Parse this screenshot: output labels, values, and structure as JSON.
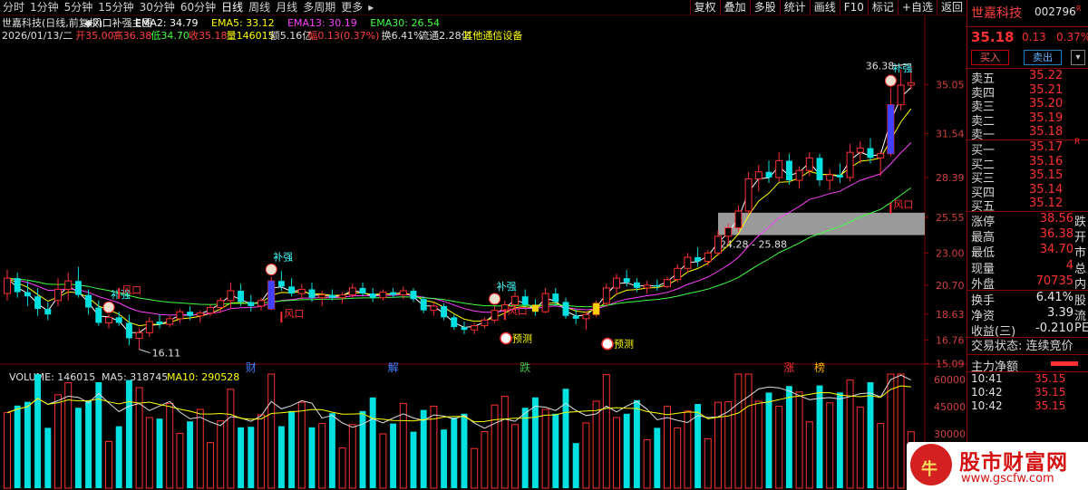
{
  "toolbar": {
    "periods": [
      "分时",
      "1分钟",
      "5分钟",
      "15分钟",
      "30分钟",
      "60分钟",
      "日线",
      "周线",
      "月线",
      "多周期",
      "更多"
    ],
    "active_period": "日线",
    "more_arrow": "▸",
    "right_buttons": [
      "复权",
      "叠加",
      "多股",
      "统计",
      "画线",
      "F10",
      "标记",
      "+自选",
      "返回"
    ]
  },
  "header": {
    "title": "世嘉科技(日线,前复权)",
    "indicator_name": "风口补强主图",
    "ema_labels": [
      "EMA2: 34.79",
      "EMA5: 33.12",
      "EMA13: 30.19",
      "EMA30: 26.54"
    ],
    "ema_colors": [
      "#ffffff",
      "#ffff00",
      "#ff40ff",
      "#40ff40"
    ],
    "info_date": "2026/01/13/二",
    "info_open": "开35.00",
    "info_high": "高36.38",
    "info_low": "低34.70",
    "info_close": "收35.18",
    "info_volume": "量146015",
    "info_amount": "额5.16亿",
    "info_range": "幅0.13(0.37%)",
    "info_turnover": "换6.41%",
    "info_float": "流通2.28亿",
    "info_sector": "其他通信设备"
  },
  "volume_header": {
    "volume": "VOLUME: 146015",
    "ma5": "MA5: 318745",
    "ma10": "MA10: 290528"
  },
  "side": {
    "name": "世嘉科技",
    "code": "002796",
    "code_flag": "R",
    "price": "35.18",
    "change": "0.13",
    "change_pct": "0.37%",
    "buy_btn": "买入",
    "sell_btn": "卖出",
    "more_btn": "▾",
    "asks": [
      {
        "label": "卖五",
        "price": "35.22"
      },
      {
        "label": "卖四",
        "price": "35.21"
      },
      {
        "label": "卖三",
        "price": "35.20"
      },
      {
        "label": "卖二",
        "price": "35.19"
      },
      {
        "label": "卖一",
        "price": "35.18"
      }
    ],
    "bids": [
      {
        "label": "买一",
        "price": "35.17",
        "flag": "R"
      },
      {
        "label": "买二",
        "price": "35.16"
      },
      {
        "label": "买三",
        "price": "35.15"
      },
      {
        "label": "买四",
        "price": "35.14"
      },
      {
        "label": "买五",
        "price": "35.12"
      }
    ],
    "stats": [
      {
        "label": "涨停",
        "value": "38.56",
        "tail": "跌",
        "color": "red"
      },
      {
        "label": "最高",
        "value": "36.38",
        "tail": "开",
        "color": "red"
      },
      {
        "label": "最低",
        "value": "34.70",
        "tail": "市",
        "color": "red"
      },
      {
        "label": "现量",
        "value": "4",
        "tail": "总",
        "color": "red"
      },
      {
        "label": "外盘",
        "value": "70735",
        "tail": "内",
        "color": "red"
      }
    ],
    "stats2": [
      {
        "label": "换手",
        "value": "6.41%",
        "tail": "股",
        "color": "white"
      },
      {
        "label": "净资",
        "value": "3.39",
        "tail": "流",
        "color": "white"
      },
      {
        "label": "收益(三)",
        "value": "-0.210",
        "tail": "PE",
        "color": "white"
      }
    ],
    "trade_status": "交易状态: 连续竞价",
    "main_flow": "主力净额",
    "ticks": [
      {
        "time": "10:41",
        "price": "35.15"
      },
      {
        "time": "10:42",
        "price": "35.15"
      },
      {
        "time": "10:42",
        "price": "35.15"
      }
    ]
  },
  "logo": {
    "text": "股市财富网",
    "url": "www.gscfw.com",
    "mark": "牛"
  },
  "chart_data": [
    {
      "type": "candlestick",
      "ylim": [
        14.6,
        37.4
      ],
      "price_ticks": [
        "35.05",
        "31.54",
        "28.39",
        "25.55",
        "23.00",
        "20.70",
        "18.63",
        "16.76",
        "15.09"
      ],
      "price_tick_values": [
        35.05,
        31.54,
        28.39,
        25.55,
        23.0,
        20.7,
        18.63,
        16.76,
        15.09
      ],
      "candles": [
        [
          20.1,
          21.8,
          19.6,
          21.2
        ],
        [
          21.2,
          21.6,
          19.8,
          20.2
        ],
        [
          20.2,
          21.0,
          19.2,
          19.9
        ],
        [
          19.9,
          20.5,
          18.5,
          19.0
        ],
        [
          19.0,
          19.5,
          18.2,
          18.6
        ],
        [
          19.6,
          21.2,
          19.2,
          20.4
        ],
        [
          20.4,
          21.6,
          19.6,
          21.0
        ],
        [
          21.0,
          22.0,
          19.8,
          20.0
        ],
        [
          20.0,
          20.4,
          18.6,
          19.1
        ],
        [
          19.1,
          19.6,
          17.8,
          18.0
        ],
        [
          18.0,
          18.6,
          17.6,
          18.4
        ],
        [
          18.4,
          18.8,
          17.8,
          18.0
        ],
        [
          18.0,
          18.6,
          16.4,
          16.9
        ],
        [
          16.9,
          17.6,
          16.1,
          17.3
        ],
        [
          17.3,
          18.4,
          17.0,
          18.1
        ],
        [
          18.1,
          18.6,
          17.6,
          17.9
        ],
        [
          17.9,
          18.5,
          17.7,
          18.3
        ],
        [
          18.3,
          19.0,
          18.0,
          18.8
        ],
        [
          18.8,
          19.2,
          18.2,
          18.5
        ],
        [
          18.5,
          18.9,
          18.0,
          18.7
        ],
        [
          18.7,
          19.3,
          18.5,
          19.1
        ],
        [
          19.1,
          19.8,
          18.7,
          19.6
        ],
        [
          19.6,
          20.9,
          19.0,
          20.3
        ],
        [
          20.3,
          20.8,
          19.2,
          19.5
        ],
        [
          19.5,
          20.0,
          18.8,
          19.2
        ],
        [
          19.2,
          19.8,
          18.9,
          19.6
        ],
        [
          19.0,
          21.3,
          18.9,
          21.0
        ],
        [
          21.0,
          21.7,
          20.3,
          20.6
        ],
        [
          20.6,
          21.2,
          19.9,
          20.1
        ],
        [
          20.1,
          20.8,
          19.7,
          20.4
        ],
        [
          20.4,
          20.9,
          19.5,
          19.8
        ],
        [
          19.8,
          20.3,
          19.2,
          20.0
        ],
        [
          20.0,
          20.4,
          19.6,
          19.8
        ],
        [
          19.8,
          20.2,
          19.4,
          20.0
        ],
        [
          20.0,
          20.8,
          19.8,
          20.5
        ],
        [
          20.5,
          20.9,
          19.9,
          20.1
        ],
        [
          20.1,
          20.5,
          19.5,
          19.8
        ],
        [
          19.8,
          20.4,
          19.6,
          20.2
        ],
        [
          20.2,
          20.5,
          19.8,
          20.0
        ],
        [
          20.0,
          20.6,
          19.7,
          20.3
        ],
        [
          20.3,
          20.5,
          19.5,
          19.7
        ],
        [
          19.7,
          19.9,
          18.7,
          18.9
        ],
        [
          18.9,
          19.5,
          18.5,
          19.2
        ],
        [
          19.2,
          19.4,
          18.2,
          18.4
        ],
        [
          18.4,
          18.6,
          17.5,
          17.7
        ],
        [
          17.7,
          18.1,
          17.2,
          17.5
        ],
        [
          17.5,
          18.0,
          17.2,
          17.8
        ],
        [
          17.8,
          18.4,
          17.6,
          18.2
        ],
        [
          18.2,
          19.2,
          18.0,
          18.9
        ],
        [
          18.9,
          19.6,
          18.5,
          19.3
        ],
        [
          19.3,
          20.2,
          18.9,
          19.9
        ],
        [
          19.9,
          20.4,
          19.0,
          19.3
        ],
        [
          19.3,
          19.7,
          18.5,
          18.8
        ],
        [
          18.8,
          20.5,
          18.7,
          20.1
        ],
        [
          20.1,
          20.5,
          19.2,
          19.5
        ],
        [
          19.5,
          19.8,
          18.3,
          18.5
        ],
        [
          18.5,
          19.0,
          17.9,
          18.3
        ],
        [
          18.3,
          18.8,
          17.5,
          18.6
        ],
        [
          18.6,
          19.6,
          18.4,
          19.4
        ],
        [
          19.4,
          20.8,
          19.2,
          20.5
        ],
        [
          20.5,
          21.5,
          20.0,
          21.2
        ],
        [
          21.2,
          21.8,
          20.6,
          20.9
        ],
        [
          20.9,
          21.2,
          20.2,
          20.5
        ],
        [
          20.5,
          21.0,
          20.1,
          20.7
        ],
        [
          20.7,
          21.1,
          20.3,
          20.6
        ],
        [
          20.6,
          21.3,
          20.5,
          21.1
        ],
        [
          21.1,
          22.2,
          20.9,
          21.9
        ],
        [
          21.9,
          23.0,
          21.6,
          22.7
        ],
        [
          22.7,
          23.4,
          22.0,
          22.4
        ],
        [
          22.4,
          23.2,
          22.1,
          23.0
        ],
        [
          23.0,
          24.6,
          22.8,
          24.2
        ],
        [
          24.2,
          25.1,
          23.6,
          24.8
        ],
        [
          24.8,
          26.4,
          24.5,
          26.0
        ],
        [
          26.0,
          28.8,
          25.8,
          28.3
        ],
        [
          28.3,
          29.3,
          27.4,
          28.8
        ],
        [
          28.8,
          29.6,
          28.0,
          28.4
        ],
        [
          28.4,
          30.2,
          28.1,
          29.6
        ],
        [
          29.6,
          30.1,
          27.9,
          28.2
        ],
        [
          28.2,
          29.2,
          27.6,
          28.9
        ],
        [
          28.9,
          30.2,
          28.5,
          29.8
        ],
        [
          29.8,
          30.1,
          27.8,
          28.2
        ],
        [
          28.2,
          29.0,
          27.5,
          28.6
        ],
        [
          28.6,
          29.4,
          28.0,
          28.4
        ],
        [
          28.4,
          30.8,
          28.1,
          30.2
        ],
        [
          30.2,
          31.0,
          29.4,
          30.5
        ],
        [
          30.5,
          31.2,
          29.4,
          29.8
        ],
        [
          29.8,
          30.3,
          28.5,
          30.1
        ],
        [
          30.1,
          34.8,
          29.9,
          33.6
        ],
        [
          33.6,
          36.1,
          33.2,
          35.0
        ],
        [
          35.0,
          36.38,
          34.7,
          35.18
        ]
      ],
      "ema2_label": "EMA2",
      "high_marker": "36.38",
      "low_marker": "16.11",
      "zone_label": "24.28 - 25.88",
      "zone_range": [
        24.28,
        25.88
      ],
      "signal_labels": {
        "bu": "补强",
        "feng": "风口",
        "yu": "预测"
      },
      "event_tags": [
        {
          "text": "财",
          "color": "#4080ff"
        },
        {
          "text": "解",
          "color": "#4080ff"
        },
        {
          "text": "跌",
          "color": "#40c040"
        },
        {
          "text": "涨",
          "color": "#ff3030"
        },
        {
          "text": "榜",
          "color": "#ffb000"
        }
      ]
    },
    {
      "type": "bar",
      "ylim": [
        0,
        64000
      ],
      "volume_ticks": [
        "60000",
        "45000",
        "30000"
      ],
      "volume_tick_values": [
        60000,
        45000,
        30000
      ]
    }
  ]
}
